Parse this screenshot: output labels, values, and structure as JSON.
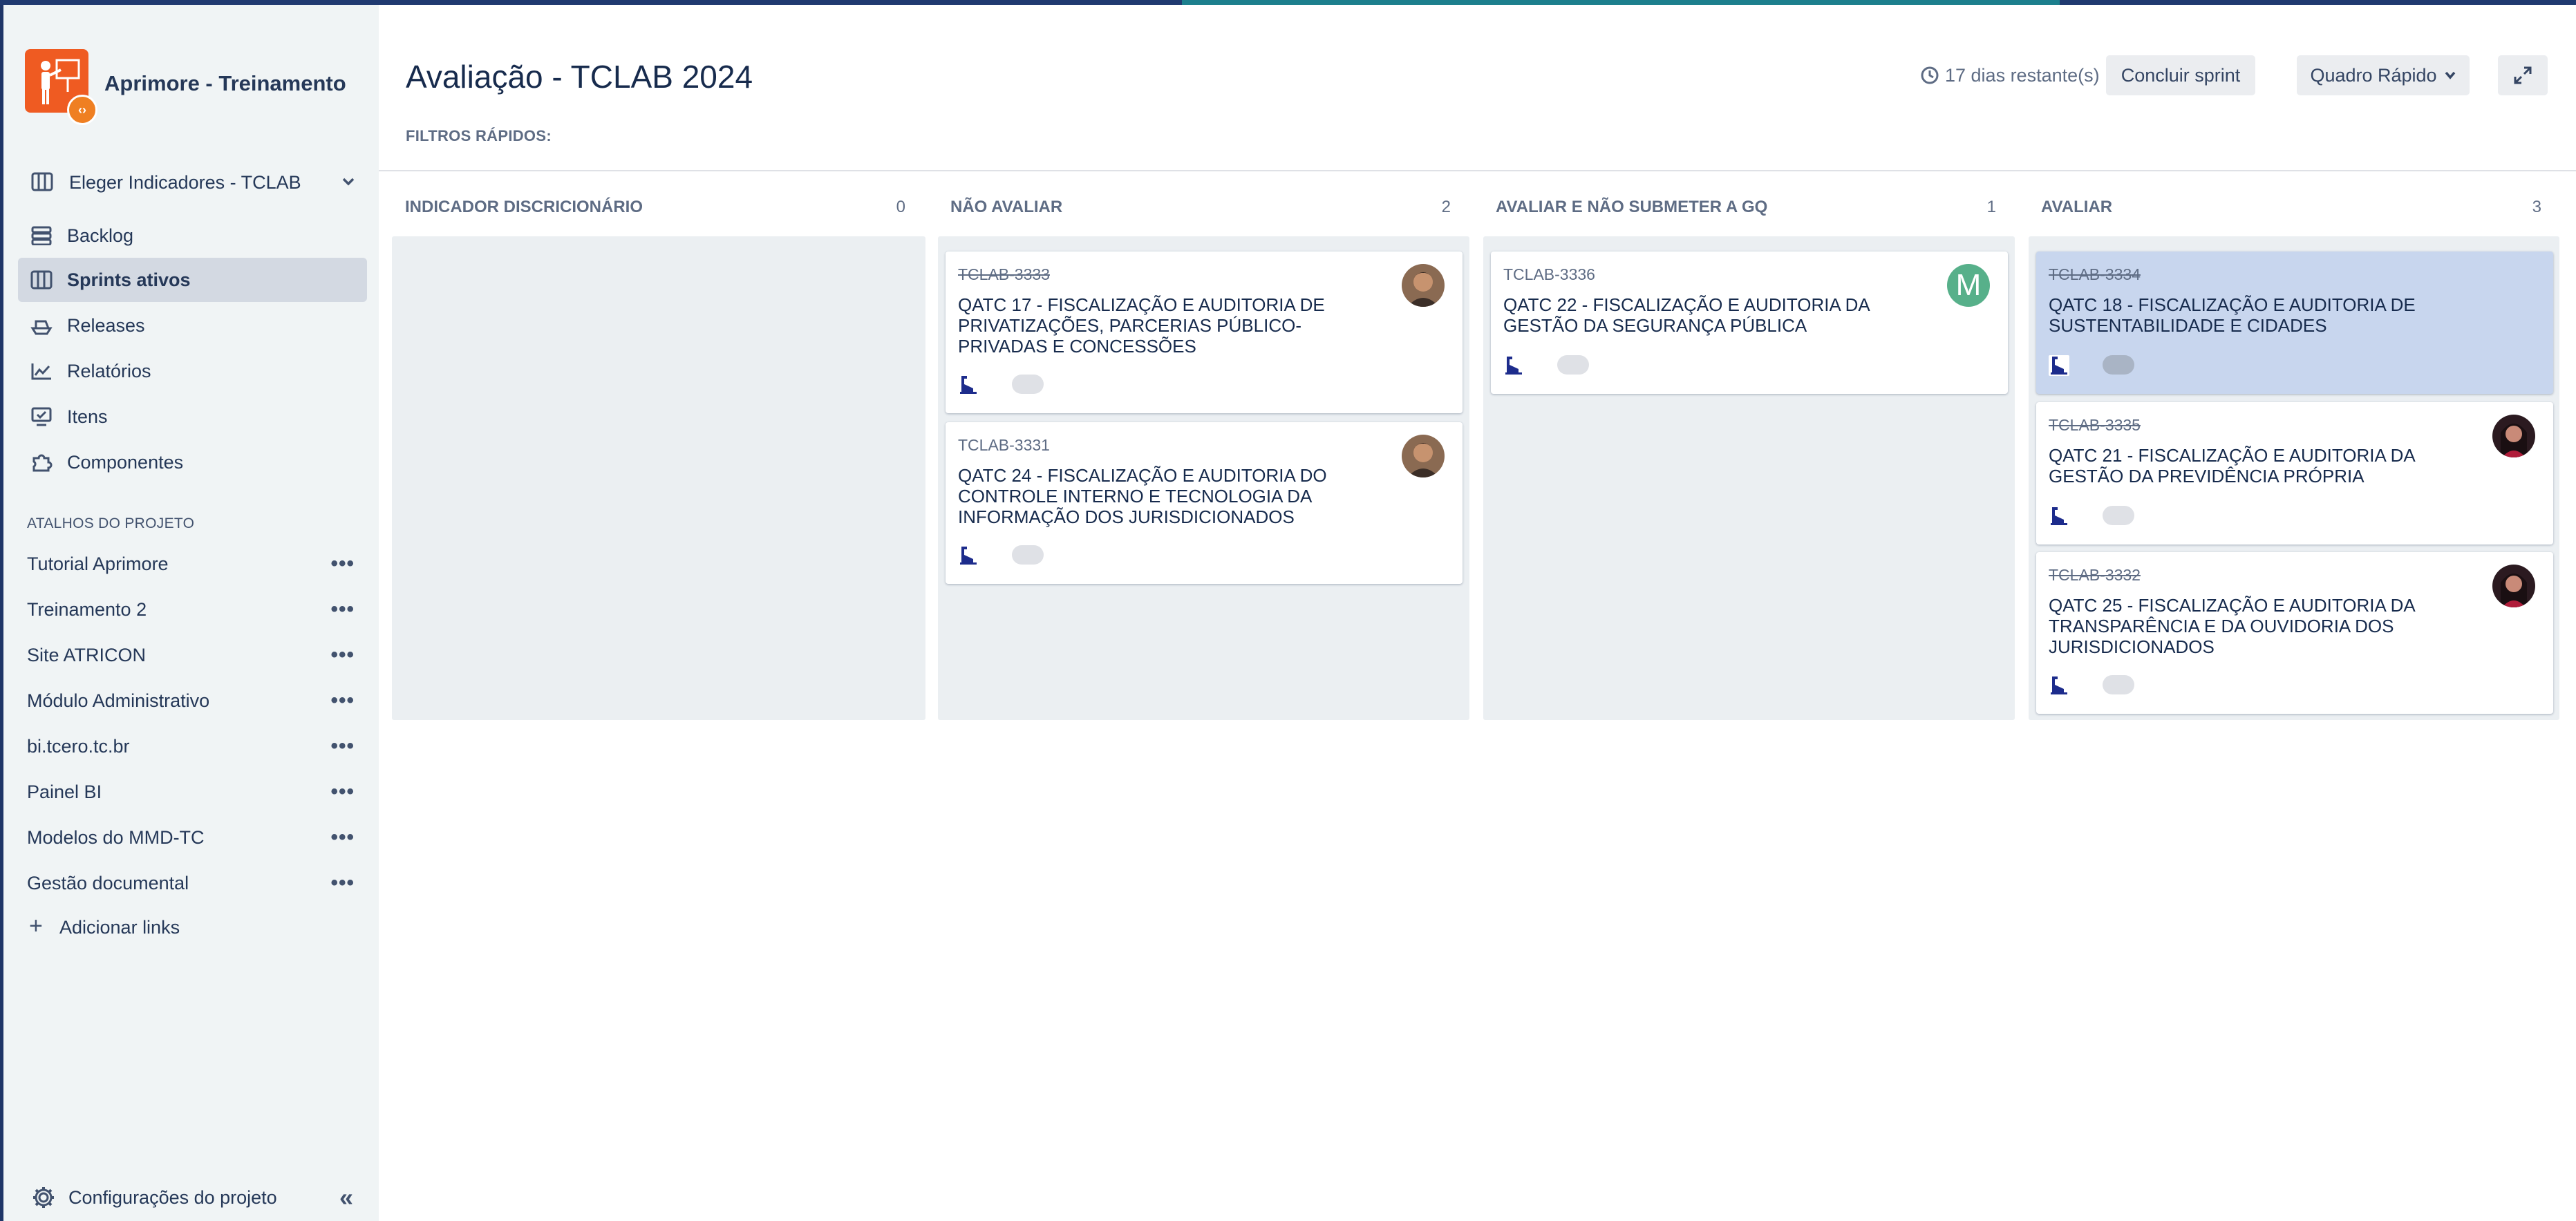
{
  "project": {
    "name": "Aprimore - Treinamento"
  },
  "board_selector": {
    "label": "Eleger Indicadores - TCLAB"
  },
  "nav": [
    {
      "label": "Backlog",
      "icon": "backlog-icon"
    },
    {
      "label": "Sprints ativos",
      "icon": "board-icon",
      "active": true
    },
    {
      "label": "Releases",
      "icon": "ship-icon"
    },
    {
      "label": "Relatórios",
      "icon": "chart-icon"
    },
    {
      "label": "Itens",
      "icon": "items-icon"
    },
    {
      "label": "Componentes",
      "icon": "puzzle-icon"
    }
  ],
  "shortcuts": {
    "title": "ATALHOS DO PROJETO",
    "items": [
      "Tutorial Aprimore",
      "Treinamento 2",
      "Site ATRICON",
      "Módulo Administrativo",
      "bi.tcero.tc.br",
      "Painel BI",
      "Modelos do MMD-TC",
      "Gestão documental"
    ],
    "add_label": "Adicionar links"
  },
  "settings_label": "Configurações do projeto",
  "header": {
    "title": "Avaliação - TCLAB 2024",
    "quick_filters": "FILTROS RÁPIDOS:",
    "days_remaining": "17 dias restante(s)",
    "end_sprint": "Concluir sprint",
    "board_mode": "Quadro Rápido"
  },
  "columns": [
    {
      "name": "INDICADOR DISCRICIONÁRIO",
      "count": "0"
    },
    {
      "name": "NÃO AVALIAR",
      "count": "2"
    },
    {
      "name": "AVALIAR E NÃO SUBMETER A GQ",
      "count": "1"
    },
    {
      "name": "AVALIAR",
      "count": "3"
    }
  ],
  "cards": [
    {
      "key": "TCLAB-3333",
      "summary": "QATC 17 - FISCALIZAÇÃO E AUDITORIA DE PRIVATIZAÇÕES, PARCERIAS PÚBLICO-PRIVADAS E CONCESSÕES",
      "done": true,
      "avatar": "photo-man"
    },
    {
      "key": "TCLAB-3331",
      "summary": "QATC 24 - FISCALIZAÇÃO E AUDITORIA DO CONTROLE INTERNO E TECNOLOGIA DA INFORMAÇÃO DOS JURISDICIONADOS",
      "done": false,
      "avatar": "photo-man"
    },
    {
      "key": "TCLAB-3336",
      "summary": "QATC 22 - FISCALIZAÇÃO E AUDITORIA DA GESTÃO DA SEGURANÇA PÚBLICA",
      "done": false,
      "avatar": "M"
    },
    {
      "key": "TCLAB-3334",
      "summary": "QATC 18 - FISCALIZAÇÃO E AUDITORIA DE SUSTENTABILIDADE E CIDADES",
      "done": true,
      "selected": true
    },
    {
      "key": "TCLAB-3335",
      "summary": "QATC 21 - FISCALIZAÇÃO E AUDITORIA DA GESTÃO DA PREVIDÊNCIA PRÓPRIA",
      "done": true,
      "avatar": "photo-woman"
    },
    {
      "key": "TCLAB-3332",
      "summary": "QATC 25 - FISCALIZAÇÃO E AUDITORIA DA TRANSPARÊNCIA E DA OUVIDORIA DOS JURISDICIONADOS",
      "done": true,
      "avatar": "photo-woman"
    }
  ],
  "colors": {
    "sidebar_bg": "#f0f4f5",
    "active_nav_bg": "#d3d9e2",
    "column_bg": "#ebeff2",
    "selected_card_bg": "#c8d6ee",
    "project_logo": "#ef5b22",
    "issue_icon": "#1d2c8c",
    "avatar_m": "#57b08a"
  }
}
